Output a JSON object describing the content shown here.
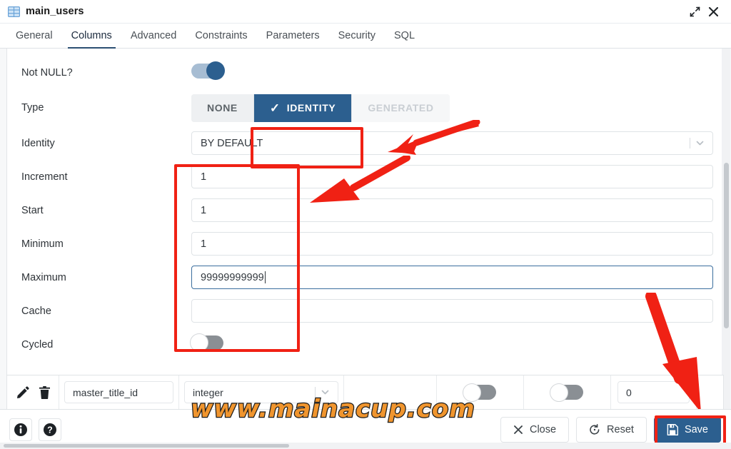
{
  "window": {
    "title": "main_users",
    "table_icon": "table-icon",
    "maximize_icon": "expand-icon",
    "close_icon": "close-icon"
  },
  "tabs": [
    {
      "label": "General",
      "active": false
    },
    {
      "label": "Columns",
      "active": true
    },
    {
      "label": "Advanced",
      "active": false
    },
    {
      "label": "Constraints",
      "active": false
    },
    {
      "label": "Parameters",
      "active": false
    },
    {
      "label": "Security",
      "active": false
    },
    {
      "label": "SQL",
      "active": false
    }
  ],
  "form": {
    "not_null": {
      "label": "Not NULL?",
      "state": "on"
    },
    "type": {
      "label": "Type",
      "options": [
        {
          "label": "NONE",
          "selected": false,
          "disabled": false
        },
        {
          "label": "IDENTITY",
          "selected": true,
          "disabled": false
        },
        {
          "label": "GENERATED",
          "selected": false,
          "disabled": true
        }
      ]
    },
    "identity": {
      "label": "Identity",
      "value": "BY DEFAULT"
    },
    "increment": {
      "label": "Increment",
      "value": "1"
    },
    "start": {
      "label": "Start",
      "value": "1"
    },
    "minimum": {
      "label": "Minimum",
      "value": "1"
    },
    "maximum": {
      "label": "Maximum",
      "value": "99999999999",
      "focused": true
    },
    "cache": {
      "label": "Cache",
      "value": ""
    },
    "cycled": {
      "label": "Cycled",
      "state": "off"
    }
  },
  "grid_row": {
    "edit_icon": "pencil-icon",
    "delete_icon": "trash-icon",
    "column_name": "master_title_id",
    "data_type": "integer",
    "toggle_1": "off",
    "toggle_2": "off",
    "length": "0"
  },
  "footer": {
    "info_label": "i",
    "help_label": "?",
    "close_label": "Close",
    "reset_label": "Reset",
    "save_label": "Save"
  },
  "watermark": {
    "text": "www.mainacup.com"
  },
  "colors": {
    "accent": "#2c5f8f",
    "annotation": "#f02114",
    "watermark": "#f0952e",
    "tab_active_underline": "#2c4f73"
  }
}
